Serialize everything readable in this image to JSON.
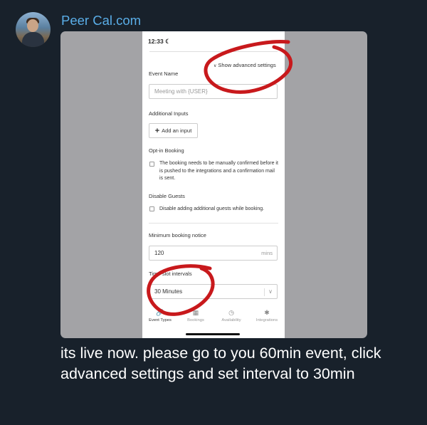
{
  "sender": {
    "name": "Peer Cal.com"
  },
  "screenshot": {
    "status_time": "12:33",
    "show_advanced_settings": "Show advanced settings",
    "event_name": {
      "label": "Event Name",
      "placeholder": "Meeting with {USER}"
    },
    "additional_inputs": {
      "label": "Additional Inputs",
      "button": "Add an input"
    },
    "opt_in_booking": {
      "label": "Opt-in Booking",
      "checkbox_text": "The booking needs to be manually confirmed before it is pushed to the integrations and a confirmation mail is sent."
    },
    "disable_guests": {
      "label": "Disable Guests",
      "checkbox_text": "Disable adding additional guests while booking."
    },
    "minimum_booking_notice": {
      "label": "Minimum booking notice",
      "value": "120",
      "unit": "mins"
    },
    "time_slot_intervals": {
      "label": "Time-slot intervals",
      "value": "30 Minutes"
    },
    "tabs": [
      {
        "label": "Event Types",
        "icon": "link-icon"
      },
      {
        "label": "Bookings",
        "icon": "calendar-icon"
      },
      {
        "label": "Availability",
        "icon": "clock-icon"
      },
      {
        "label": "Integrations",
        "icon": "puzzle-icon"
      }
    ],
    "annotation_color": "#c8191c"
  },
  "message": {
    "text": "its live now. please go to you 60min event, click advanced settings and set interval to 30min"
  }
}
